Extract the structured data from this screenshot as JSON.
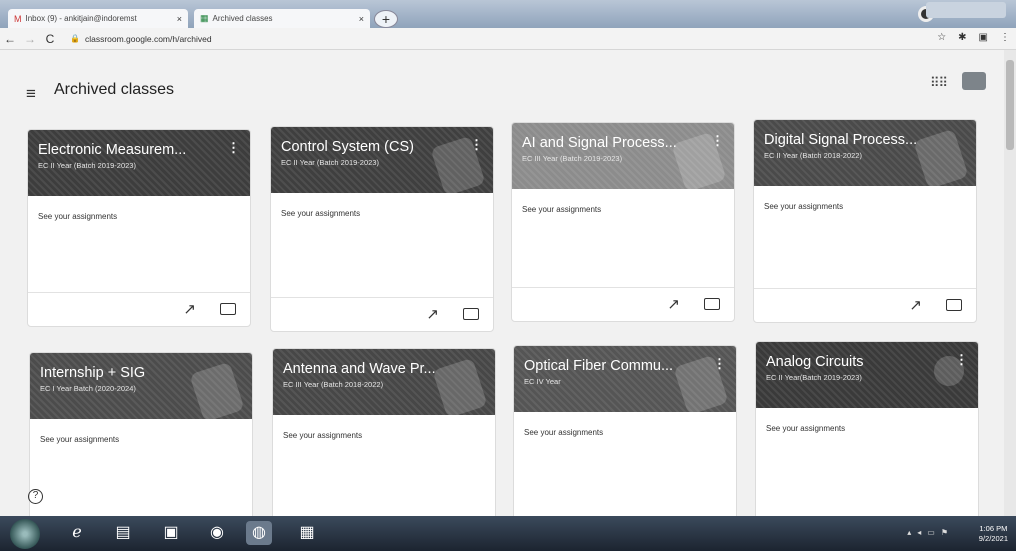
{
  "browser": {
    "tabs": [
      {
        "label": "Inbox (9) - ankitjain@indoremst",
        "active": false
      },
      {
        "label": "Archived classes",
        "active": true
      }
    ],
    "url": "classroom.google.com/h/archived"
  },
  "header": {
    "title": "Archived classes"
  },
  "cards": [
    {
      "title": "Electronic Measurem...",
      "subtitle": "EC II Year (Batch 2019-2023)",
      "assignments": "See your assignments",
      "color": "#3d3d3d"
    },
    {
      "title": "Control System (CS)",
      "subtitle": "EC II Year (Batch 2019-2023)",
      "assignments": "See your assignments",
      "color": "#3f3f3f"
    },
    {
      "title": "AI and Signal Process...",
      "subtitle": "EC III Year (Batch 2019-2023)",
      "assignments": "See your assignments",
      "color": "#8c8c8c"
    },
    {
      "title": "Digital Signal Process...",
      "subtitle": "EC II Year (Batch 2018-2022)",
      "assignments": "See your assignments",
      "color": "#4a4a4a"
    },
    {
      "title": "Internship + SIG",
      "subtitle": "EC I Year Batch (2020-2024)",
      "assignments": "See your assignments",
      "color": "#4c4c4c"
    },
    {
      "title": "Antenna and Wave Pr...",
      "subtitle": "EC III Year (Batch 2018-2022)",
      "assignments": "See your assignments",
      "color": "#474747"
    },
    {
      "title": "Optical Fiber Commu...",
      "subtitle": "EC IV Year",
      "assignments": "See your assignments",
      "color": "#555555"
    },
    {
      "title": "Analog Circuits",
      "subtitle": "EC II Year(Batch 2019-2023)",
      "assignments": "See your assignments",
      "color": "#3a3a3a"
    }
  ],
  "taskbar": {
    "time": "1:06 PM",
    "date": "9/2/2021"
  }
}
